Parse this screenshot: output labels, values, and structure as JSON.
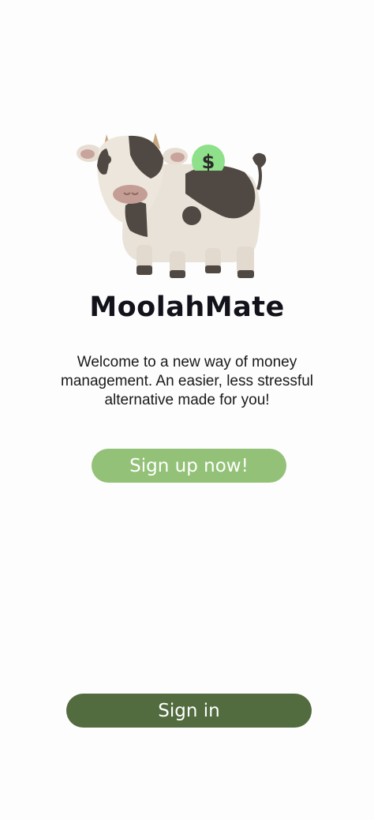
{
  "app": {
    "title": "MoolahMate",
    "welcome_text": "Welcome to a new way of money management. An easier, less stressful alternative made for you!"
  },
  "mascot": {
    "icon": "cow-piggy-bank-icon",
    "coin_symbol": "$"
  },
  "buttons": {
    "signup_label": "Sign up now!",
    "signin_label": "Sign in"
  },
  "colors": {
    "signup_button": "#93c177",
    "signin_button": "#526b3f",
    "coin": "#8fe08a"
  }
}
